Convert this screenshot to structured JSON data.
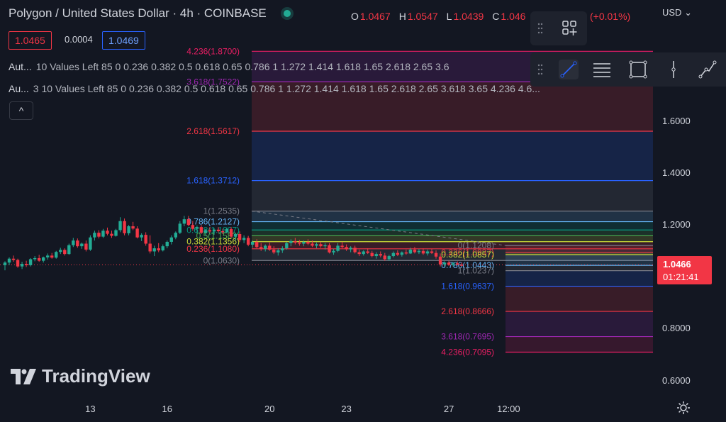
{
  "header": {
    "title": "Polygon / United States Dollar · 4h · COINBASE",
    "ohlc": [
      {
        "key": "O",
        "value": "1.0467"
      },
      {
        "key": "H",
        "value": "1.0547"
      },
      {
        "key": "L",
        "value": "1.0439"
      },
      {
        "key": "C",
        "value": "1.046"
      }
    ],
    "change": "(+0.01%)",
    "sell_price": "1.0465",
    "spread": "0.0004",
    "buy_price": "1.0469",
    "collapse_glyph": "^"
  },
  "indicators": [
    {
      "name": "Aut...",
      "params": "10 Values Left 85 0 0.236 0.382 0.5 0.618 0.65 0.786 1 1.272 1.414 1.618 1.65 2.618 2.65 3.6"
    },
    {
      "name": "Au...",
      "params": "3 10 Values Left 85 0 0.236 0.382 0.5 0.618 0.65 0.786 1 1.272 1.414 1.618 1.65 2.618 2.65 3.618 3.65 4.236 4.6..."
    }
  ],
  "toolbar": {
    "icons": [
      "drag-handle-icon",
      "add-object-icon",
      "trend-line-icon",
      "fib-levels-icon",
      "rectangle-icon",
      "vertical-line-icon",
      "path-icon"
    ]
  },
  "price_axis": {
    "currency": "USD",
    "current_price": "1.0466",
    "countdown": "01:21:41"
  },
  "logo_text": "TradingView",
  "chart_data": {
    "type": "candlestick",
    "symbol": "Polygon / United States Dollar",
    "interval": "4h",
    "exchange": "COINBASE",
    "y_ticks": [
      0.6,
      0.8,
      1.2,
      1.4,
      1.6
    ],
    "y_tick_labels": [
      "0.6000",
      "0.8000",
      "1.2000",
      "1.4000",
      "1.6000"
    ],
    "ylim": [
      0.55,
      1.75
    ],
    "x_ticks": [
      {
        "label": "13",
        "index": 20
      },
      {
        "label": "16",
        "index": 38
      },
      {
        "label": "20",
        "index": 62
      },
      {
        "label": "23",
        "index": 80
      },
      {
        "label": "27",
        "index": 104
      },
      {
        "label": "12:00",
        "index": 118
      }
    ],
    "colors": {
      "up": "#22ab94",
      "down": "#f23645",
      "background": "#131722"
    },
    "candles": [
      {
        "o": 1.045,
        "h": 1.06,
        "l": 1.025,
        "c": 1.055
      },
      {
        "o": 1.055,
        "h": 1.075,
        "l": 1.045,
        "c": 1.07
      },
      {
        "o": 1.07,
        "h": 1.082,
        "l": 1.058,
        "c": 1.065
      },
      {
        "o": 1.065,
        "h": 1.07,
        "l": 1.035,
        "c": 1.04
      },
      {
        "o": 1.04,
        "h": 1.058,
        "l": 1.03,
        "c": 1.05
      },
      {
        "o": 1.05,
        "h": 1.062,
        "l": 1.038,
        "c": 1.045
      },
      {
        "o": 1.045,
        "h": 1.072,
        "l": 1.04,
        "c": 1.068
      },
      {
        "o": 1.068,
        "h": 1.08,
        "l": 1.06,
        "c": 1.072
      },
      {
        "o": 1.072,
        "h": 1.085,
        "l": 1.058,
        "c": 1.062
      },
      {
        "o": 1.062,
        "h": 1.078,
        "l": 1.055,
        "c": 1.075
      },
      {
        "o": 1.075,
        "h": 1.09,
        "l": 1.066,
        "c": 1.082
      },
      {
        "o": 1.082,
        "h": 1.092,
        "l": 1.07,
        "c": 1.074
      },
      {
        "o": 1.074,
        "h": 1.1,
        "l": 1.07,
        "c": 1.096
      },
      {
        "o": 1.096,
        "h": 1.112,
        "l": 1.088,
        "c": 1.104
      },
      {
        "o": 1.104,
        "h": 1.11,
        "l": 1.082,
        "c": 1.088
      },
      {
        "o": 1.088,
        "h": 1.128,
        "l": 1.085,
        "c": 1.122
      },
      {
        "o": 1.122,
        "h": 1.15,
        "l": 1.115,
        "c": 1.14
      },
      {
        "o": 1.14,
        "h": 1.148,
        "l": 1.112,
        "c": 1.118
      },
      {
        "o": 1.118,
        "h": 1.132,
        "l": 1.108,
        "c": 1.128
      },
      {
        "o": 1.128,
        "h": 1.14,
        "l": 1.098,
        "c": 1.105
      },
      {
        "o": 1.105,
        "h": 1.16,
        "l": 1.1,
        "c": 1.152
      },
      {
        "o": 1.152,
        "h": 1.178,
        "l": 1.14,
        "c": 1.17
      },
      {
        "o": 1.17,
        "h": 1.18,
        "l": 1.148,
        "c": 1.155
      },
      {
        "o": 1.155,
        "h": 1.185,
        "l": 1.15,
        "c": 1.178
      },
      {
        "o": 1.178,
        "h": 1.19,
        "l": 1.16,
        "c": 1.166
      },
      {
        "o": 1.166,
        "h": 1.178,
        "l": 1.15,
        "c": 1.158
      },
      {
        "o": 1.158,
        "h": 1.185,
        "l": 1.155,
        "c": 1.18
      },
      {
        "o": 1.18,
        "h": 1.23,
        "l": 1.172,
        "c": 1.215
      },
      {
        "o": 1.215,
        "h": 1.225,
        "l": 1.16,
        "c": 1.168
      },
      {
        "o": 1.168,
        "h": 1.2,
        "l": 1.16,
        "c": 1.195
      },
      {
        "o": 1.195,
        "h": 1.212,
        "l": 1.18,
        "c": 1.186
      },
      {
        "o": 1.186,
        "h": 1.195,
        "l": 1.148,
        "c": 1.152
      },
      {
        "o": 1.152,
        "h": 1.168,
        "l": 1.138,
        "c": 1.162
      },
      {
        "o": 1.162,
        "h": 1.172,
        "l": 1.12,
        "c": 1.128
      },
      {
        "o": 1.128,
        "h": 1.16,
        "l": 1.09,
        "c": 1.098
      },
      {
        "o": 1.098,
        "h": 1.12,
        "l": 1.08,
        "c": 1.11
      },
      {
        "o": 1.11,
        "h": 1.13,
        "l": 1.095,
        "c": 1.102
      },
      {
        "o": 1.102,
        "h": 1.125,
        "l": 1.098,
        "c": 1.118
      },
      {
        "o": 1.118,
        "h": 1.14,
        "l": 1.11,
        "c": 1.135
      },
      {
        "o": 1.135,
        "h": 1.16,
        "l": 1.125,
        "c": 1.152
      },
      {
        "o": 1.152,
        "h": 1.175,
        "l": 1.145,
        "c": 1.17
      },
      {
        "o": 1.17,
        "h": 1.215,
        "l": 1.165,
        "c": 1.205
      },
      {
        "o": 1.205,
        "h": 1.235,
        "l": 1.195,
        "c": 1.222
      },
      {
        "o": 1.222,
        "h": 1.235,
        "l": 1.195,
        "c": 1.2
      },
      {
        "o": 1.2,
        "h": 1.215,
        "l": 1.178,
        "c": 1.185
      },
      {
        "o": 1.185,
        "h": 1.198,
        "l": 1.168,
        "c": 1.192
      },
      {
        "o": 1.192,
        "h": 1.2,
        "l": 1.165,
        "c": 1.17
      },
      {
        "o": 1.17,
        "h": 1.185,
        "l": 1.158,
        "c": 1.18
      },
      {
        "o": 1.18,
        "h": 1.192,
        "l": 1.168,
        "c": 1.175
      },
      {
        "o": 1.175,
        "h": 1.188,
        "l": 1.162,
        "c": 1.182
      },
      {
        "o": 1.182,
        "h": 1.192,
        "l": 1.17,
        "c": 1.176
      },
      {
        "o": 1.176,
        "h": 1.185,
        "l": 1.165,
        "c": 1.172
      },
      {
        "o": 1.172,
        "h": 1.19,
        "l": 1.168,
        "c": 1.184
      },
      {
        "o": 1.184,
        "h": 1.192,
        "l": 1.15,
        "c": 1.155
      },
      {
        "o": 1.155,
        "h": 1.17,
        "l": 1.14,
        "c": 1.165
      },
      {
        "o": 1.165,
        "h": 1.175,
        "l": 1.135,
        "c": 1.142
      },
      {
        "o": 1.142,
        "h": 1.16,
        "l": 1.13,
        "c": 1.15
      },
      {
        "o": 1.15,
        "h": 1.158,
        "l": 1.118,
        "c": 1.124
      },
      {
        "o": 1.124,
        "h": 1.14,
        "l": 1.112,
        "c": 1.135
      },
      {
        "o": 1.135,
        "h": 1.145,
        "l": 1.11,
        "c": 1.115
      },
      {
        "o": 1.115,
        "h": 1.13,
        "l": 1.1,
        "c": 1.108
      },
      {
        "o": 1.108,
        "h": 1.125,
        "l": 1.098,
        "c": 1.12
      },
      {
        "o": 1.12,
        "h": 1.132,
        "l": 1.1,
        "c": 1.105
      },
      {
        "o": 1.105,
        "h": 1.118,
        "l": 1.088,
        "c": 1.094
      },
      {
        "o": 1.094,
        "h": 1.11,
        "l": 1.082,
        "c": 1.102
      },
      {
        "o": 1.102,
        "h": 1.118,
        "l": 1.092,
        "c": 1.11
      },
      {
        "o": 1.11,
        "h": 1.135,
        "l": 1.105,
        "c": 1.13
      },
      {
        "o": 1.13,
        "h": 1.145,
        "l": 1.118,
        "c": 1.138
      },
      {
        "o": 1.138,
        "h": 1.15,
        "l": 1.125,
        "c": 1.132
      },
      {
        "o": 1.132,
        "h": 1.142,
        "l": 1.12,
        "c": 1.128
      },
      {
        "o": 1.128,
        "h": 1.14,
        "l": 1.118,
        "c": 1.135
      },
      {
        "o": 1.135,
        "h": 1.145,
        "l": 1.122,
        "c": 1.128
      },
      {
        "o": 1.128,
        "h": 1.14,
        "l": 1.115,
        "c": 1.12
      },
      {
        "o": 1.12,
        "h": 1.132,
        "l": 1.11,
        "c": 1.126
      },
      {
        "o": 1.126,
        "h": 1.135,
        "l": 1.112,
        "c": 1.118
      },
      {
        "o": 1.118,
        "h": 1.13,
        "l": 1.105,
        "c": 1.122
      },
      {
        "o": 1.122,
        "h": 1.13,
        "l": 1.09,
        "c": 1.094
      },
      {
        "o": 1.094,
        "h": 1.108,
        "l": 1.085,
        "c": 1.1
      },
      {
        "o": 1.1,
        "h": 1.13,
        "l": 1.095,
        "c": 1.12
      },
      {
        "o": 1.12,
        "h": 1.135,
        "l": 1.11,
        "c": 1.115
      },
      {
        "o": 1.115,
        "h": 1.125,
        "l": 1.1,
        "c": 1.106
      },
      {
        "o": 1.106,
        "h": 1.118,
        "l": 1.095,
        "c": 1.112
      },
      {
        "o": 1.112,
        "h": 1.12,
        "l": 1.09,
        "c": 1.095
      },
      {
        "o": 1.095,
        "h": 1.105,
        "l": 1.08,
        "c": 1.088
      },
      {
        "o": 1.088,
        "h": 1.102,
        "l": 1.082,
        "c": 1.098
      },
      {
        "o": 1.098,
        "h": 1.11,
        "l": 1.088,
        "c": 1.092
      },
      {
        "o": 1.092,
        "h": 1.1,
        "l": 1.075,
        "c": 1.08
      },
      {
        "o": 1.08,
        "h": 1.095,
        "l": 1.07,
        "c": 1.088
      },
      {
        "o": 1.088,
        "h": 1.098,
        "l": 1.075,
        "c": 1.082
      },
      {
        "o": 1.082,
        "h": 1.092,
        "l": 1.062,
        "c": 1.068
      },
      {
        "o": 1.068,
        "h": 1.085,
        "l": 1.062,
        "c": 1.08
      },
      {
        "o": 1.08,
        "h": 1.098,
        "l": 1.075,
        "c": 1.092
      },
      {
        "o": 1.092,
        "h": 1.102,
        "l": 1.08,
        "c": 1.085
      },
      {
        "o": 1.085,
        "h": 1.098,
        "l": 1.078,
        "c": 1.094
      },
      {
        "o": 1.094,
        "h": 1.105,
        "l": 1.085,
        "c": 1.09
      },
      {
        "o": 1.09,
        "h": 1.112,
        "l": 1.088,
        "c": 1.105
      },
      {
        "o": 1.105,
        "h": 1.115,
        "l": 1.09,
        "c": 1.095
      },
      {
        "o": 1.095,
        "h": 1.108,
        "l": 1.088,
        "c": 1.1
      },
      {
        "o": 1.1,
        "h": 1.11,
        "l": 1.085,
        "c": 1.09
      },
      {
        "o": 1.09,
        "h": 1.105,
        "l": 1.082,
        "c": 1.098
      },
      {
        "o": 1.098,
        "h": 1.108,
        "l": 1.088,
        "c": 1.092
      },
      {
        "o": 1.092,
        "h": 1.102,
        "l": 1.07,
        "c": 1.078
      },
      {
        "o": 1.078,
        "h": 1.09,
        "l": 1.04,
        "c": 1.048
      },
      {
        "o": 1.048,
        "h": 1.06,
        "l": 1.04,
        "c": 1.055
      },
      {
        "o": 1.055,
        "h": 1.062,
        "l": 1.042,
        "c": 1.046
      },
      {
        "o": 1.046,
        "h": 1.058,
        "l": 1.04,
        "c": 1.052
      },
      {
        "o": 1.052,
        "h": 1.06,
        "l": 1.044,
        "c": 1.047
      },
      {
        "o": 1.0467,
        "h": 1.0547,
        "l": 1.0439,
        "c": 1.0466
      }
    ],
    "fib_left": {
      "levels": [
        {
          "ratio": "4.236",
          "value": 1.87,
          "label": "4.236(1.8700)",
          "color": "#e91e63"
        },
        {
          "ratio": "3.618",
          "value": 1.7522,
          "label": "3.618(1.7522)",
          "color": "#9c27b0"
        },
        {
          "ratio": "2.618",
          "value": 1.5617,
          "label": "2.618(1.5617)",
          "color": "#f23645"
        },
        {
          "ratio": "1.618",
          "value": 1.3712,
          "label": "1.618(1.3712)",
          "color": "#2962ff"
        },
        {
          "ratio": "1",
          "value": 1.2535,
          "label": "1(1.2535)",
          "color": "#787b86"
        },
        {
          "ratio": "0.786",
          "value": 1.2127,
          "label": "0.786(1.2127)",
          "color": "#64b5f6"
        },
        {
          "ratio": "0.618",
          "value": 1.1807,
          "label": "0.618(1.1807)",
          "color": "#089981"
        },
        {
          "ratio": "0.5",
          "value": 1.1583,
          "label": "0.5(1.1583)",
          "color": "#4caf50"
        },
        {
          "ratio": "0.382",
          "value": 1.1356,
          "label": "0.382(1.1356)",
          "color": "#cddc39"
        },
        {
          "ratio": "0.236",
          "value": 1.108,
          "label": "0.236(1.1080)",
          "color": "#f23645"
        },
        {
          "ratio": "0",
          "value": 1.063,
          "label": "0(1.0630)",
          "color": "#787b86"
        }
      ]
    },
    "fib_right": {
      "levels": [
        {
          "ratio": "0",
          "value": 1.1208,
          "label": "0(1.1208)",
          "color": "#787b86"
        },
        {
          "ratio": "0.236",
          "value": 1.0937,
          "label": "0.236(1.0937)",
          "color": "#f23645"
        },
        {
          "ratio": "0.382",
          "value": 1.0857,
          "label": "0.382(1.0857)",
          "color": "#cddc39"
        },
        {
          "ratio": "0.786",
          "value": 1.0443,
          "label": "0.786(1.0443)",
          "color": "#64b5f6"
        },
        {
          "ratio": "1",
          "value": 1.0237,
          "label": "1(1.0237)",
          "color": "#787b86"
        },
        {
          "ratio": "1.618",
          "value": 0.9637,
          "label": "1.618(0.9637)",
          "color": "#2962ff"
        },
        {
          "ratio": "2.618",
          "value": 0.8666,
          "label": "2.618(0.8666)",
          "color": "#f23645"
        },
        {
          "ratio": "3.618",
          "value": 0.7695,
          "label": "3.618(0.7695)",
          "color": "#9c27b0"
        },
        {
          "ratio": "4.236",
          "value": 0.7095,
          "label": "4.236(0.7095)",
          "color": "#e91e63"
        }
      ]
    }
  }
}
